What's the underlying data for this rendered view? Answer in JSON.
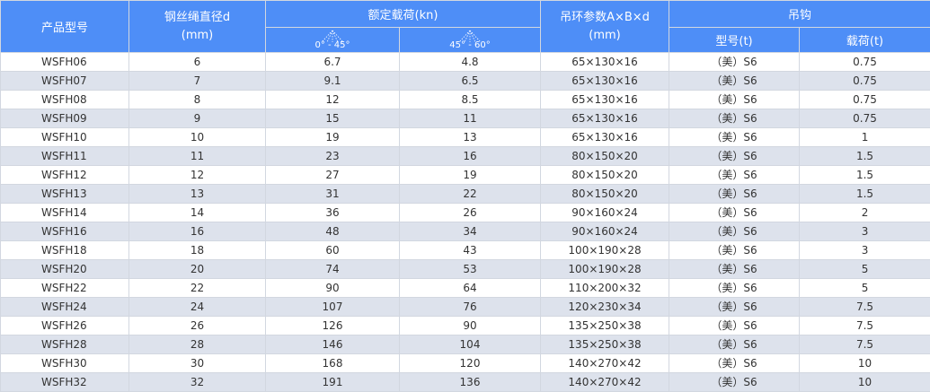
{
  "header": {
    "model": "产品型号",
    "diameter_line1": "钢丝绳直径d",
    "diameter_line2": "(mm)",
    "rated_load": "额定载荷(kn)",
    "angle1": "0°  -  45°",
    "angle2": "45°  -  60°",
    "ring_line1": "吊环参数A×B×d",
    "ring_line2": "(mm)",
    "hook": "吊钩",
    "hook_type": "型号(t)",
    "hook_load": "载荷(t)"
  },
  "icons": {
    "angle": "angle-fan-icon"
  },
  "colors": {
    "header_bg": "#4e8ef7",
    "stripe": "#dde2ec"
  },
  "rows": [
    {
      "model": "WSFH06",
      "d": "6",
      "l1": "6.7",
      "l2": "4.8",
      "ring": "65×130×16",
      "hook": "（美）S6",
      "load": "0.75"
    },
    {
      "model": "WSFH07",
      "d": "7",
      "l1": "9.1",
      "l2": "6.5",
      "ring": "65×130×16",
      "hook": "（美）S6",
      "load": "0.75"
    },
    {
      "model": "WSFH08",
      "d": "8",
      "l1": "12",
      "l2": "8.5",
      "ring": "65×130×16",
      "hook": "（美）S6",
      "load": "0.75"
    },
    {
      "model": "WSFH09",
      "d": "9",
      "l1": "15",
      "l2": "11",
      "ring": "65×130×16",
      "hook": "（美）S6",
      "load": "0.75"
    },
    {
      "model": "WSFH10",
      "d": "10",
      "l1": "19",
      "l2": "13",
      "ring": "65×130×16",
      "hook": "（美）S6",
      "load": "1"
    },
    {
      "model": "WSFH11",
      "d": "11",
      "l1": "23",
      "l2": "16",
      "ring": "80×150×20",
      "hook": "（美）S6",
      "load": "1.5"
    },
    {
      "model": "WSFH12",
      "d": "12",
      "l1": "27",
      "l2": "19",
      "ring": "80×150×20",
      "hook": "（美）S6",
      "load": "1.5"
    },
    {
      "model": "WSFH13",
      "d": "13",
      "l1": "31",
      "l2": "22",
      "ring": "80×150×20",
      "hook": "（美）S6",
      "load": "1.5"
    },
    {
      "model": "WSFH14",
      "d": "14",
      "l1": "36",
      "l2": "26",
      "ring": "90×160×24",
      "hook": "（美）S6",
      "load": "2"
    },
    {
      "model": "WSFH16",
      "d": "16",
      "l1": "48",
      "l2": "34",
      "ring": "90×160×24",
      "hook": "（美）S6",
      "load": "3"
    },
    {
      "model": "WSFH18",
      "d": "18",
      "l1": "60",
      "l2": "43",
      "ring": "100×190×28",
      "hook": "（美）S6",
      "load": "3"
    },
    {
      "model": "WSFH20",
      "d": "20",
      "l1": "74",
      "l2": "53",
      "ring": "100×190×28",
      "hook": "（美）S6",
      "load": "5"
    },
    {
      "model": "WSFH22",
      "d": "22",
      "l1": "90",
      "l2": "64",
      "ring": "110×200×32",
      "hook": "（美）S6",
      "load": "5"
    },
    {
      "model": "WSFH24",
      "d": "24",
      "l1": "107",
      "l2": "76",
      "ring": "120×230×34",
      "hook": "（美）S6",
      "load": "7.5"
    },
    {
      "model": "WSFH26",
      "d": "26",
      "l1": "126",
      "l2": "90",
      "ring": "135×250×38",
      "hook": "（美）S6",
      "load": "7.5"
    },
    {
      "model": "WSFH28",
      "d": "28",
      "l1": "146",
      "l2": "104",
      "ring": "135×250×38",
      "hook": "（美）S6",
      "load": "7.5"
    },
    {
      "model": "WSFH30",
      "d": "30",
      "l1": "168",
      "l2": "120",
      "ring": "140×270×42",
      "hook": "（美）S6",
      "load": "10"
    },
    {
      "model": "WSFH32",
      "d": "32",
      "l1": "191",
      "l2": "136",
      "ring": "140×270×42",
      "hook": "（美）S6",
      "load": "10"
    }
  ]
}
